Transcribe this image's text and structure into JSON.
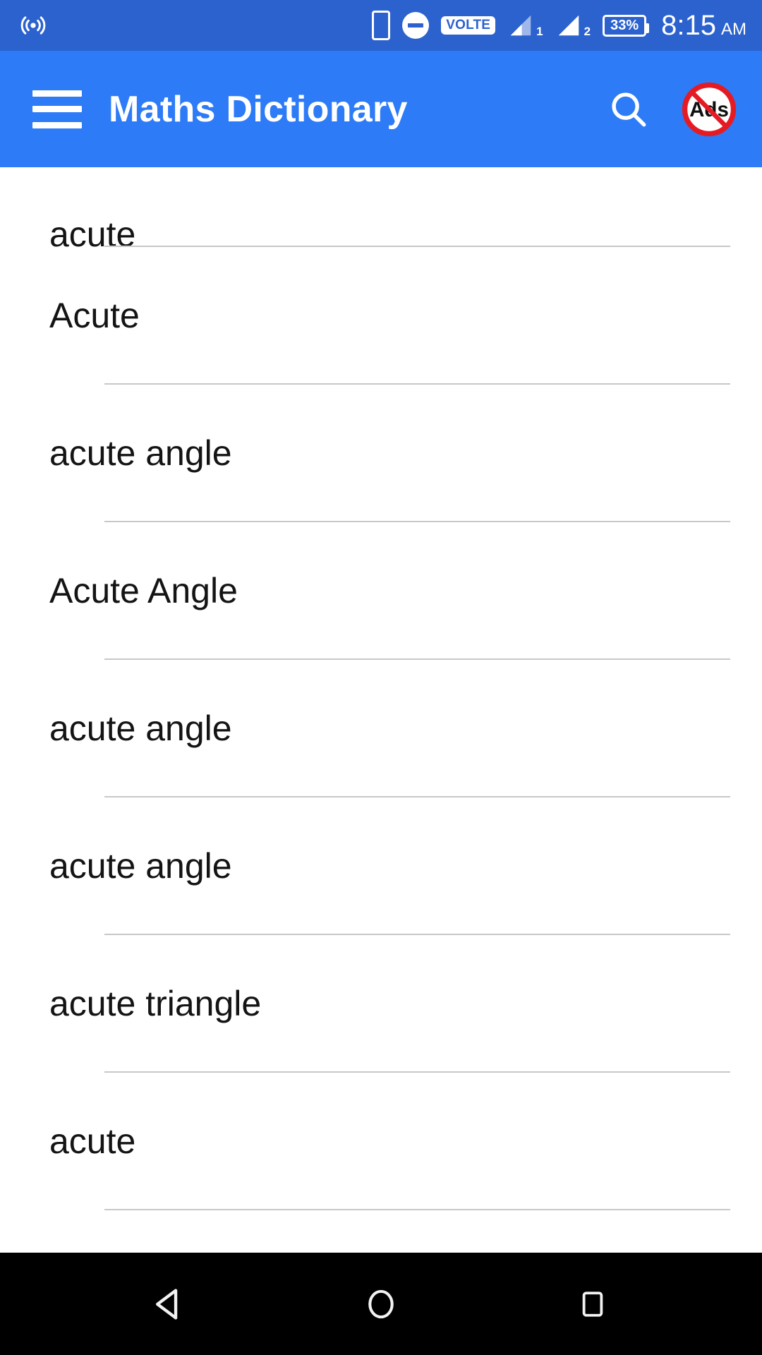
{
  "status_bar": {
    "background": "#2C62CE",
    "icons": [
      "cast-icon",
      "phone-icon",
      "do-not-disturb-icon",
      "volte-badge",
      "signal-1-icon",
      "signal-2-icon"
    ],
    "volte_label": "VOLTE",
    "sim1_label": "1",
    "sim2_label": "2",
    "battery_level": "33%",
    "time": "8:15",
    "time_period": "AM"
  },
  "app_bar": {
    "background": "#2D7BF7",
    "title": "Maths Dictionary",
    "menu_icon": "hamburger-menu-icon",
    "search_icon": "search-icon",
    "no_ads_icon": "no-ads-icon",
    "no_ads_label": "Ads"
  },
  "list": {
    "items": [
      {
        "label": "acute"
      },
      {
        "label": "Acute"
      },
      {
        "label": "acute angle"
      },
      {
        "label": "Acute Angle"
      },
      {
        "label": "acute angle"
      },
      {
        "label": "acute angle"
      },
      {
        "label": "acute triangle"
      },
      {
        "label": "acute"
      }
    ]
  },
  "nav_bar": {
    "background": "#000000",
    "buttons": [
      {
        "name": "back-button",
        "icon": "back-triangle-icon"
      },
      {
        "name": "home-button",
        "icon": "home-circle-icon"
      },
      {
        "name": "recents-button",
        "icon": "recents-square-icon"
      }
    ]
  }
}
